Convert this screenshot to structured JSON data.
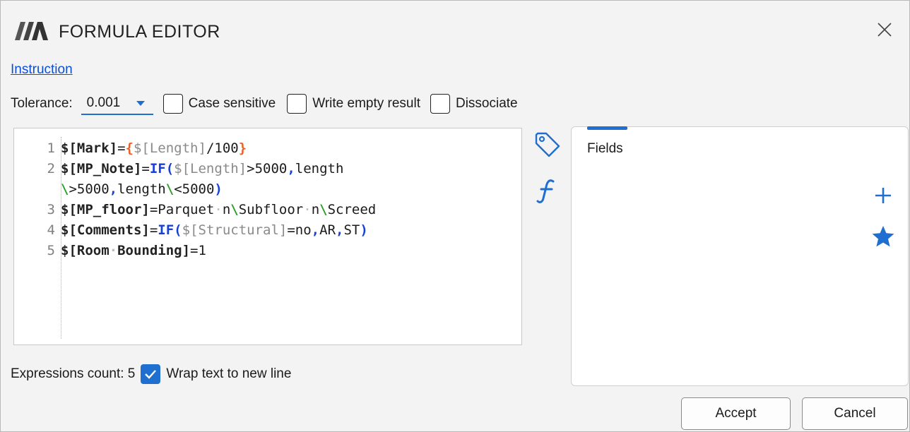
{
  "window": {
    "title": "FORMULA EDITOR"
  },
  "links": {
    "instruction": "Instruction"
  },
  "options": {
    "tolerance_label": "Tolerance:",
    "tolerance_value": "0.001",
    "case_sensitive": {
      "label": "Case sensitive",
      "checked": false
    },
    "write_empty_result": {
      "label": "Write empty result",
      "checked": false
    },
    "dissociate": {
      "label": "Dissociate",
      "checked": false
    }
  },
  "editor": {
    "line_numbers": [
      "1",
      "2",
      "",
      "3",
      "4",
      "5"
    ],
    "lines": [
      "$[Mark]={$[Length]/100}",
      "$[MP_Note]=IF($[Length]>5000,length",
      "\\>5000,length\\<5000)",
      "$[MP_floor]=Parquet·n\\Subfloor·n\\Screed",
      "$[Comments]=IF($[Structural]=no,AR,ST)",
      "$[Room·Bounding]=1"
    ]
  },
  "side_icons": [
    "tag-icon",
    "function-icon"
  ],
  "fields_panel": {
    "tab_label": "Fields",
    "buttons": [
      "add-icon",
      "star-icon"
    ]
  },
  "footer": {
    "expressions_count": "Expressions count: 5",
    "wrap_text": {
      "label": "Wrap text to new line",
      "checked": true
    }
  },
  "buttons": {
    "accept": "Accept",
    "cancel": "Cancel"
  },
  "colors": {
    "accent": "#1f6fd1",
    "function_keyword": "#1a3fd6",
    "brace": "#e8632b",
    "field_ref": "#8a8a8a",
    "escape": "#2aa02a",
    "link": "#0b4fd3"
  }
}
